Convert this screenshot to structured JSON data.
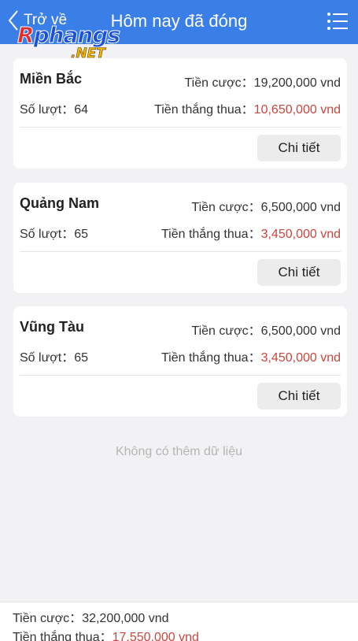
{
  "header": {
    "back_label": "Trở về",
    "title": "Hôm nay đã đóng",
    "menu_icon": "list-menu-icon",
    "back_icon": "chevron-left-icon",
    "bg_color": "#3a7ee8"
  },
  "logo": {
    "main": "Rphangs",
    "net": ".NET"
  },
  "labels": {
    "bet": "Tiền cược：",
    "count": "Số lượt：",
    "winloss": "Tiền thắng thua：",
    "detail": "Chi tiết"
  },
  "cards": [
    {
      "name": "Miền Bắc",
      "bet": "19,200,000 vnd",
      "count": "64",
      "winloss": "10,650,000 vnd"
    },
    {
      "name": "Quảng Nam",
      "bet": "6,500,000 vnd",
      "count": "65",
      "winloss": "3,450,000 vnd"
    },
    {
      "name": "Vũng Tàu",
      "bet": "6,500,000 vnd",
      "count": "65",
      "winloss": "3,450,000 vnd"
    }
  ],
  "no_more": "Không có thêm dữ liệu",
  "footer": {
    "bet_label": "Tiền cược：",
    "bet_total": "32,200,000 vnd",
    "winloss_label": "Tiền thắng thua：",
    "winloss_total": "17,550,000 vnd"
  },
  "colors": {
    "accent": "#3a7ee8",
    "winloss": "#c9463d"
  }
}
